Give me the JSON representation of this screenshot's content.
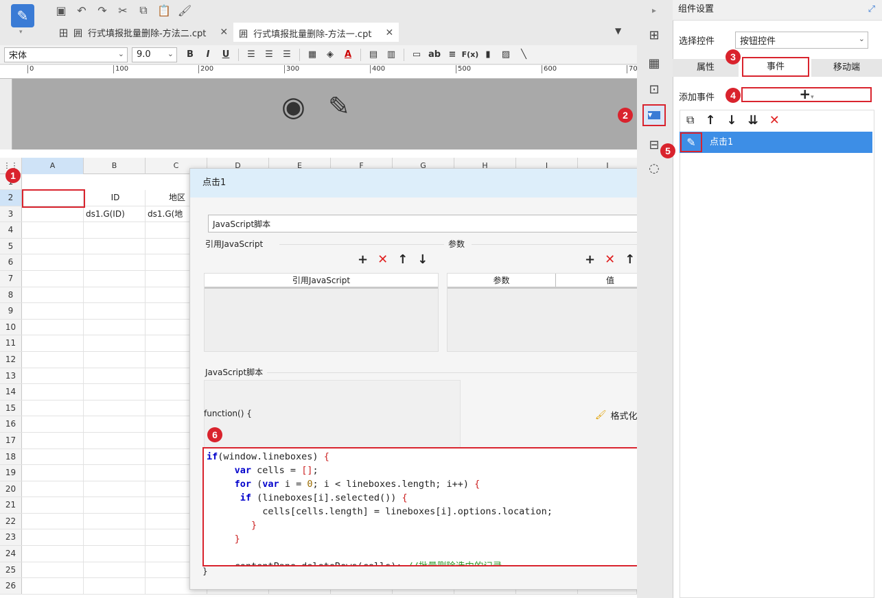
{
  "tabs": [
    {
      "label": "行式填报批量删除-方法二.cpt"
    },
    {
      "label": "行式填报批量删除-方法一.cpt"
    }
  ],
  "format": {
    "font": "宋体",
    "size": "9.0",
    "bold": "B",
    "italic": "I",
    "underline": "U",
    "text_ab": "ab",
    "fx": "F(x)"
  },
  "ruler": {
    "ticks": [
      "0",
      "100",
      "200",
      "300",
      "400",
      "500",
      "600",
      "70"
    ]
  },
  "grid": {
    "columns": [
      "A",
      "B",
      "C",
      "D",
      "E",
      "F",
      "G",
      "H",
      "I",
      "J"
    ],
    "row_numbers": [
      "1",
      "2",
      "3",
      "4",
      "5",
      "6",
      "7",
      "8",
      "9",
      "10",
      "11",
      "12",
      "13",
      "14",
      "15",
      "16",
      "17",
      "18",
      "19",
      "20",
      "21",
      "22",
      "23",
      "24",
      "25",
      "26"
    ],
    "row2": {
      "b": "ID",
      "c": "地区"
    },
    "row3": {
      "b": "ds1.G(ID)",
      "c": "ds1.G(地"
    }
  },
  "dialog": {
    "title": "点击1",
    "type_select": "JavaScript脚本",
    "ref_js_label": "引用JavaScript",
    "params_label": "参数",
    "ref_js_col": "引用JavaScript",
    "params_col": "参数",
    "value_col": "值",
    "script_label": "JavaScript脚本",
    "func_open": "function() {",
    "format_code": "格式化代码",
    "func_close": "}"
  },
  "panel": {
    "header": "组件设置",
    "select_label": "选择控件",
    "select_value": "按钮控件",
    "tabs": [
      "属性",
      "事件",
      "移动端"
    ],
    "add_event": "添加事件",
    "add_symbol": "+",
    "event_item": "点击1"
  },
  "badges": [
    "1",
    "2",
    "3",
    "4",
    "5",
    "6"
  ],
  "colors": {
    "accent": "#3a7bd5",
    "highlight": "#d9232d",
    "selected_row": "#3d8ee6"
  }
}
